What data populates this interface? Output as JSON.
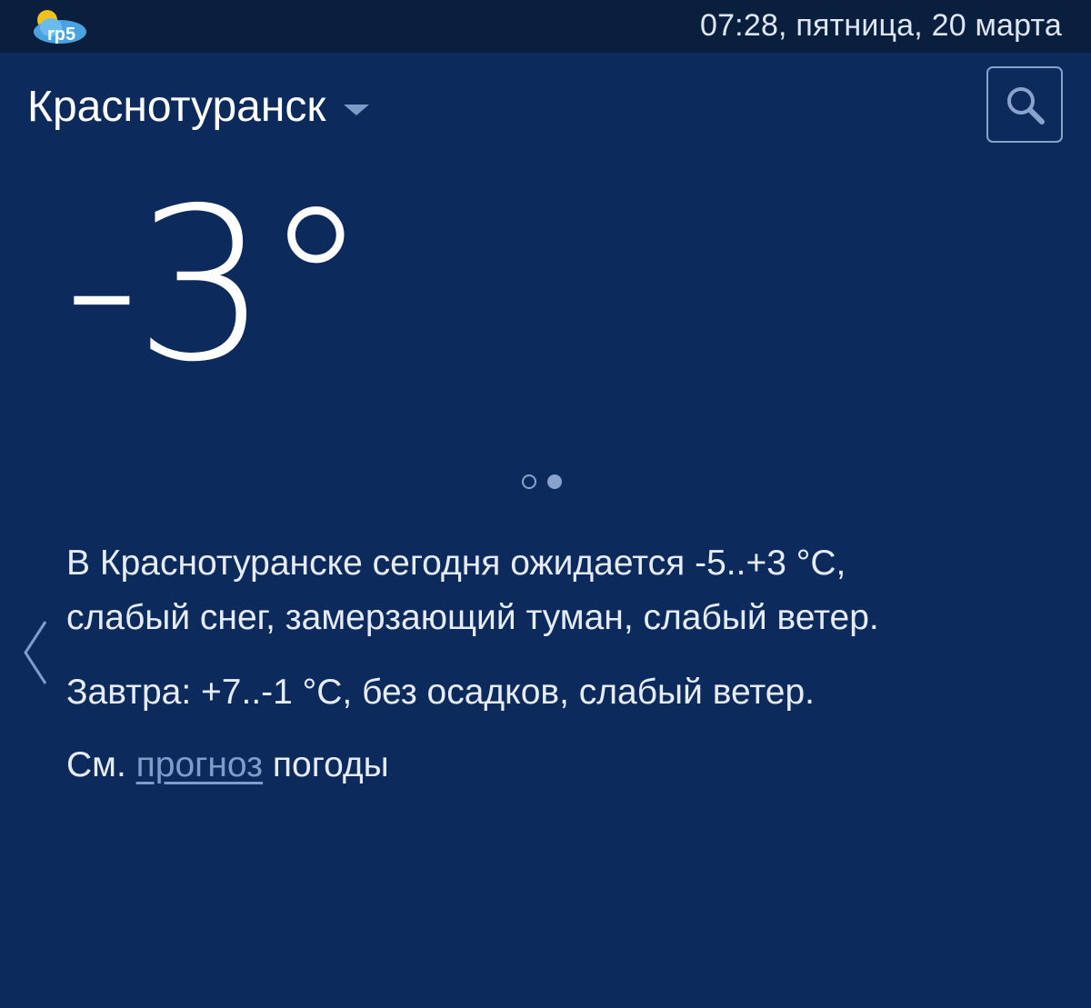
{
  "status_bar": {
    "logo_text": "rp5",
    "datetime": "07:28, пятница, 20 марта"
  },
  "header": {
    "city": "Краснотуранск",
    "city_dropdown_icon": "caret-down-icon",
    "search_icon": "search-icon"
  },
  "current": {
    "temperature": "-3°"
  },
  "pager": {
    "page_count": 2,
    "active_page": 2
  },
  "forecast": {
    "today_line1": "В Краснотуранске сегодня ожидается -5..+3 °С,",
    "today_line2": "слабый снег, замерзающий туман, слабый ветер.",
    "tomorrow": "Завтра: +7..-1 °С, без осадков, слабый ветер.",
    "see_prefix": "См.",
    "see_link": "прогноз",
    "see_suffix": "погоды"
  },
  "navigation": {
    "prev_icon": "chevron-left-icon"
  },
  "colors": {
    "background": "#0d2a5d",
    "status_bar": "#0a1e3d",
    "accent": "#7f9ccc",
    "text": "#e6ecf6"
  }
}
